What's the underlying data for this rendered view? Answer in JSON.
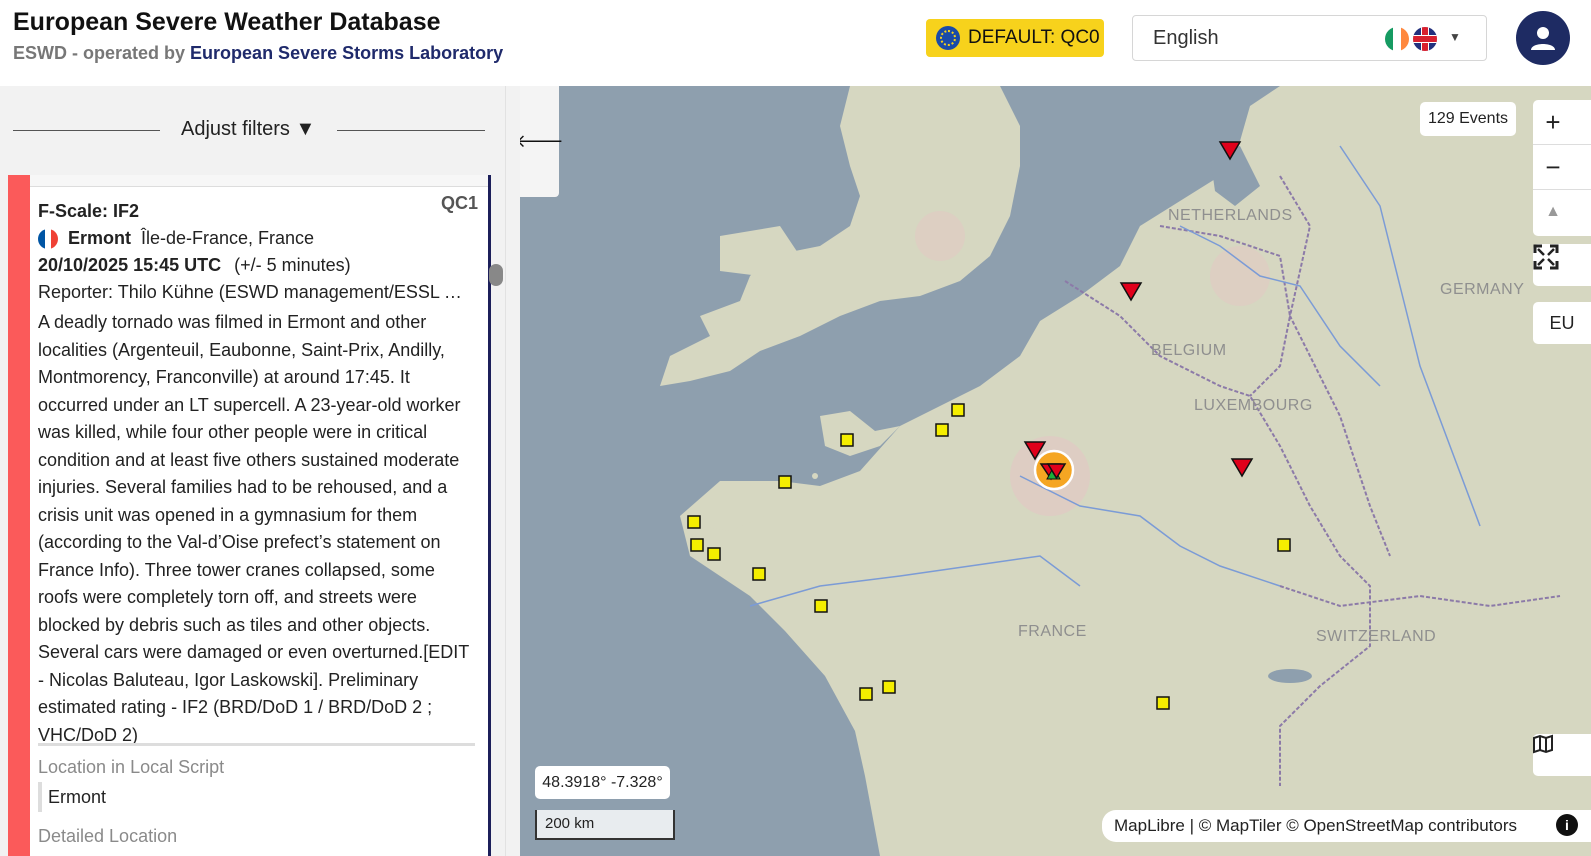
{
  "header": {
    "title": "European Severe Weather Database",
    "subtitle_prefix": "ESWD - operated by",
    "subtitle_org": "European Severe Storms Laboratory",
    "qc_badge": "DEFAULT: QC0",
    "language": "English"
  },
  "filters": {
    "label": "Adjust filters ▼"
  },
  "event": {
    "qc": "QC1",
    "fscale": "F-Scale: IF2",
    "city": "Ermont",
    "region": "Île-de-France, France",
    "datetime": "20/10/2025 15:45 UTC",
    "uncertainty": "(+/- 5 minutes)",
    "reporter": "Reporter: Thilo Kühne (ESWD management/ESSL Team)",
    "description": "A deadly tornado was filmed in Ermont and other localities (Argenteuil, Eaubonne, Saint-Prix, Andilly, Montmorency, Franconville) at around 17:45. It occurred under an LT supercell. A 23-year-old worker was killed, while four other people were in critical condition and at least five others sustained moderate injuries. Several families had to be rehoused, and a crisis unit was opened in a gymnasium for them (according to the Val-d’Oise prefect’s statement on France Info). Three tower cranes collapsed, some roofs were completely torn off, and streets were blocked by debris such as tiles and other objects. Several cars were damaged or even overturned.[EDIT - Nicolas Baluteau, Igor Laskowski]. Preliminary estimated rating - IF2 (BRD/DoD 1 / BRD/DoD 2 ; VHC/DoD 2)",
    "local_script_label": "Location in Local Script",
    "local_script_value": "Ermont",
    "detailed_location_label": "Detailed Location"
  },
  "map": {
    "events_count": "129 Events",
    "zoom_in": "+",
    "zoom_out": "−",
    "compass": "▲",
    "region_button": "EU",
    "coordinates": "48.3918° -7.328°",
    "scale": "200 km",
    "attribution": "MapLibre | © MapTiler © OpenStreetMap contributors",
    "labels": {
      "netherlands": "NETHERLANDS",
      "belgium": "BELGIUM",
      "luxembourg": "LUXEMBOURG",
      "germany": "GERMANY",
      "france": "FRANCE",
      "switzerland": "SWITZERLAND"
    },
    "colors": {
      "sea": "#8e9fae",
      "land": "#d8d8c2",
      "report_marker": "#f5ee00",
      "tornado_marker": "#e0001b",
      "selected_ring": "#f5a623"
    }
  },
  "icons": {
    "back": "arrow-left-icon",
    "user": "user-icon",
    "fullscreen": "fullscreen-icon",
    "map_layers": "map-icon",
    "info": "info-icon"
  }
}
